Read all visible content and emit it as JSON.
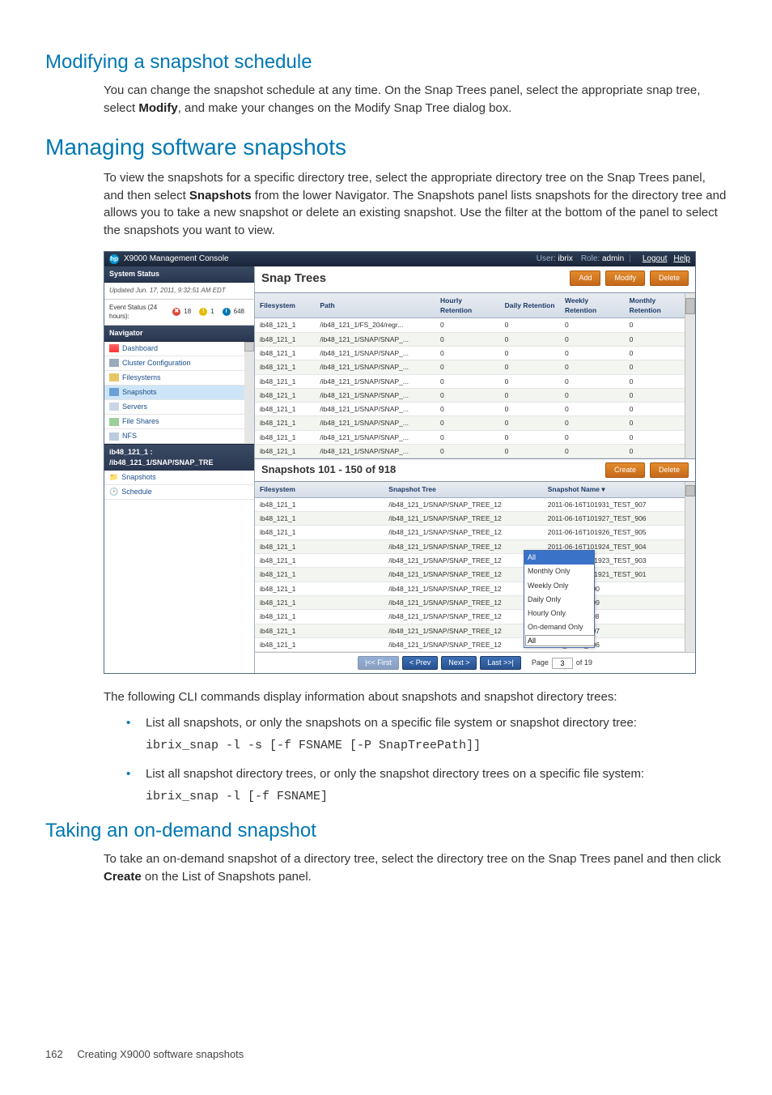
{
  "sections": {
    "mod_title": "Modifying a snapshot schedule",
    "mod_p1a": "You can change the snapshot schedule at any time. On the Snap Trees panel, select the appropriate snap tree, select ",
    "mod_p1_b": "Modify",
    "mod_p1c": ", and make your changes on the Modify Snap Tree dialog box.",
    "mng_title": "Managing software snapshots",
    "mng_p1a": "To view the snapshots for a specific directory tree, select the appropriate directory tree on the Snap Trees panel, and then select ",
    "mng_p1_b": "Snapshots",
    "mng_p1c": " from the lower Navigator. The Snapshots panel lists snapshots for the directory tree and allows you to take a new snapshot or delete an existing snapshot. Use the filter at the bottom of the panel to select the snapshots you want to view.",
    "cli_intro": "The following CLI commands display information about snapshots and snapshot directory trees:",
    "bul1": "List all snapshots, or only the snapshots on a specific file system or snapshot directory tree:",
    "code1": "ibrix_snap -l -s [-f FSNAME [-P SnapTreePath]]",
    "bul2": "List all snapshot directory trees, or only the snapshot directory trees on a specific file system:",
    "code2": "ibrix_snap -l [-f FSNAME]",
    "ond_title": "Taking an on-demand snapshot",
    "ond_p1a": "To take an on-demand snapshot of a directory tree, select the directory tree on the Snap Trees panel and then click ",
    "ond_p1_b": "Create",
    "ond_p1c": " on the List of Snapshots panel."
  },
  "footer": {
    "page": "162",
    "text": "Creating X9000 software snapshots"
  },
  "console": {
    "title": "X9000 Management Console",
    "user_lbl": "User:",
    "user_val": "ibrix",
    "role_lbl": "Role:",
    "role_val": "admin",
    "logout": "Logout",
    "help": "Help",
    "system_status": "System Status",
    "updated": "Updated Jun. 17, 2011, 9:32:51 AM EDT",
    "event_label": "Event Status (24 hours):",
    "ev": {
      "err": "18",
      "warn": "1",
      "info": "648"
    },
    "navigator": "Navigator",
    "nav_items": [
      {
        "label": "Dashboard"
      },
      {
        "label": "Cluster Configuration"
      },
      {
        "label": "Filesystems"
      },
      {
        "label": "Snapshots",
        "selected": true
      },
      {
        "label": "Servers"
      },
      {
        "label": "File Shares"
      },
      {
        "label": "NFS"
      }
    ],
    "breadcrumb": "ib48_121_1 : /ib48_121_1/SNAP/SNAP_TRE",
    "subnav": [
      {
        "label": "Snapshots"
      },
      {
        "label": "Schedule"
      }
    ],
    "snap_trees_title": "Snap Trees",
    "btn_add": "Add",
    "btn_modify": "Modify",
    "btn_delete": "Delete",
    "st_cols": [
      "Filesystem",
      "Path",
      "Hourly Retention",
      "Daily Retention",
      "Weekly Retention",
      "Monthly Retention"
    ],
    "st_rows": [
      {
        "fs": "ib48_121_1",
        "path": "/ib48_121_1/FS_204/regr...",
        "h": "0",
        "d": "0",
        "w": "0",
        "m": "0"
      },
      {
        "fs": "ib48_121_1",
        "path": "/ib48_121_1/SNAP/SNAP_...",
        "h": "0",
        "d": "0",
        "w": "0",
        "m": "0"
      },
      {
        "fs": "ib48_121_1",
        "path": "/ib48_121_1/SNAP/SNAP_...",
        "h": "0",
        "d": "0",
        "w": "0",
        "m": "0"
      },
      {
        "fs": "ib48_121_1",
        "path": "/ib48_121_1/SNAP/SNAP_...",
        "h": "0",
        "d": "0",
        "w": "0",
        "m": "0"
      },
      {
        "fs": "ib48_121_1",
        "path": "/ib48_121_1/SNAP/SNAP_...",
        "h": "0",
        "d": "0",
        "w": "0",
        "m": "0"
      },
      {
        "fs": "ib48_121_1",
        "path": "/ib48_121_1/SNAP/SNAP_...",
        "h": "0",
        "d": "0",
        "w": "0",
        "m": "0"
      },
      {
        "fs": "ib48_121_1",
        "path": "/ib48_121_1/SNAP/SNAP_...",
        "h": "0",
        "d": "0",
        "w": "0",
        "m": "0"
      },
      {
        "fs": "ib48_121_1",
        "path": "/ib48_121_1/SNAP/SNAP_...",
        "h": "0",
        "d": "0",
        "w": "0",
        "m": "0"
      },
      {
        "fs": "ib48_121_1",
        "path": "/ib48_121_1/SNAP/SNAP_...",
        "h": "0",
        "d": "0",
        "w": "0",
        "m": "0"
      },
      {
        "fs": "ib48_121_1",
        "path": "/ib48_121_1/SNAP/SNAP_...",
        "h": "0",
        "d": "0",
        "w": "0",
        "m": "0"
      }
    ],
    "list_title": "Snapshots 101 - 150 of 918",
    "btn_create": "Create",
    "btn_delete2": "Delete",
    "sn_cols": [
      "Filesystem",
      "Snapshot Tree",
      "Snapshot Name ▾"
    ],
    "sn_rows": [
      {
        "fs": "ib48_121_1",
        "tree": "/ib48_121_1/SNAP/SNAP_TREE_12",
        "name": "2011-06-16T101931_TEST_907"
      },
      {
        "fs": "ib48_121_1",
        "tree": "/ib48_121_1/SNAP/SNAP_TREE_12",
        "name": "2011-06-16T101927_TEST_906"
      },
      {
        "fs": "ib48_121_1",
        "tree": "/ib48_121_1/SNAP/SNAP_TREE_12",
        "name": "2011-06-16T101926_TEST_905"
      },
      {
        "fs": "ib48_121_1",
        "tree": "/ib48_121_1/SNAP/SNAP_TREE_12",
        "name": "2011-06-16T101924_TEST_904"
      },
      {
        "fs": "ib48_121_1",
        "tree": "/ib48_121_1/SNAP/SNAP_TREE_12",
        "name": "2011-06-16T101923_TEST_903"
      },
      {
        "fs": "ib48_121_1",
        "tree": "/ib48_121_1/SNAP/SNAP_TREE_12",
        "name": "2011-06-16T101921_TEST_901"
      },
      {
        "fs": "ib48_121_1",
        "tree": "/ib48_121_1/SNAP/SNAP_TREE_12",
        "name": "1918_TEST_900"
      },
      {
        "fs": "ib48_121_1",
        "tree": "/ib48_121_1/SNAP/SNAP_TREE_12",
        "name": "1916_TEST_899"
      },
      {
        "fs": "ib48_121_1",
        "tree": "/ib48_121_1/SNAP/SNAP_TREE_12",
        "name": "1911_TEST_898"
      },
      {
        "fs": "ib48_121_1",
        "tree": "/ib48_121_1/SNAP/SNAP_TREE_12",
        "name": "1907_TEST_897"
      },
      {
        "fs": "ib48_121_1",
        "tree": "/ib48_121_1/SNAP/SNAP_TREE_12",
        "name": "1903_TEST_896"
      }
    ],
    "dropdown": {
      "items": [
        "All",
        "Monthly Only",
        "Weekly Only",
        "Daily Only",
        "Hourly Only",
        "On-demand Only"
      ],
      "selected": "All",
      "input_val": "All"
    },
    "pager": {
      "first": "|<< First",
      "prev": "< Prev",
      "next": "Next >",
      "last": "Last >>|",
      "page_lbl": "Page",
      "page_val": "3",
      "of_lbl": "of 19"
    }
  }
}
